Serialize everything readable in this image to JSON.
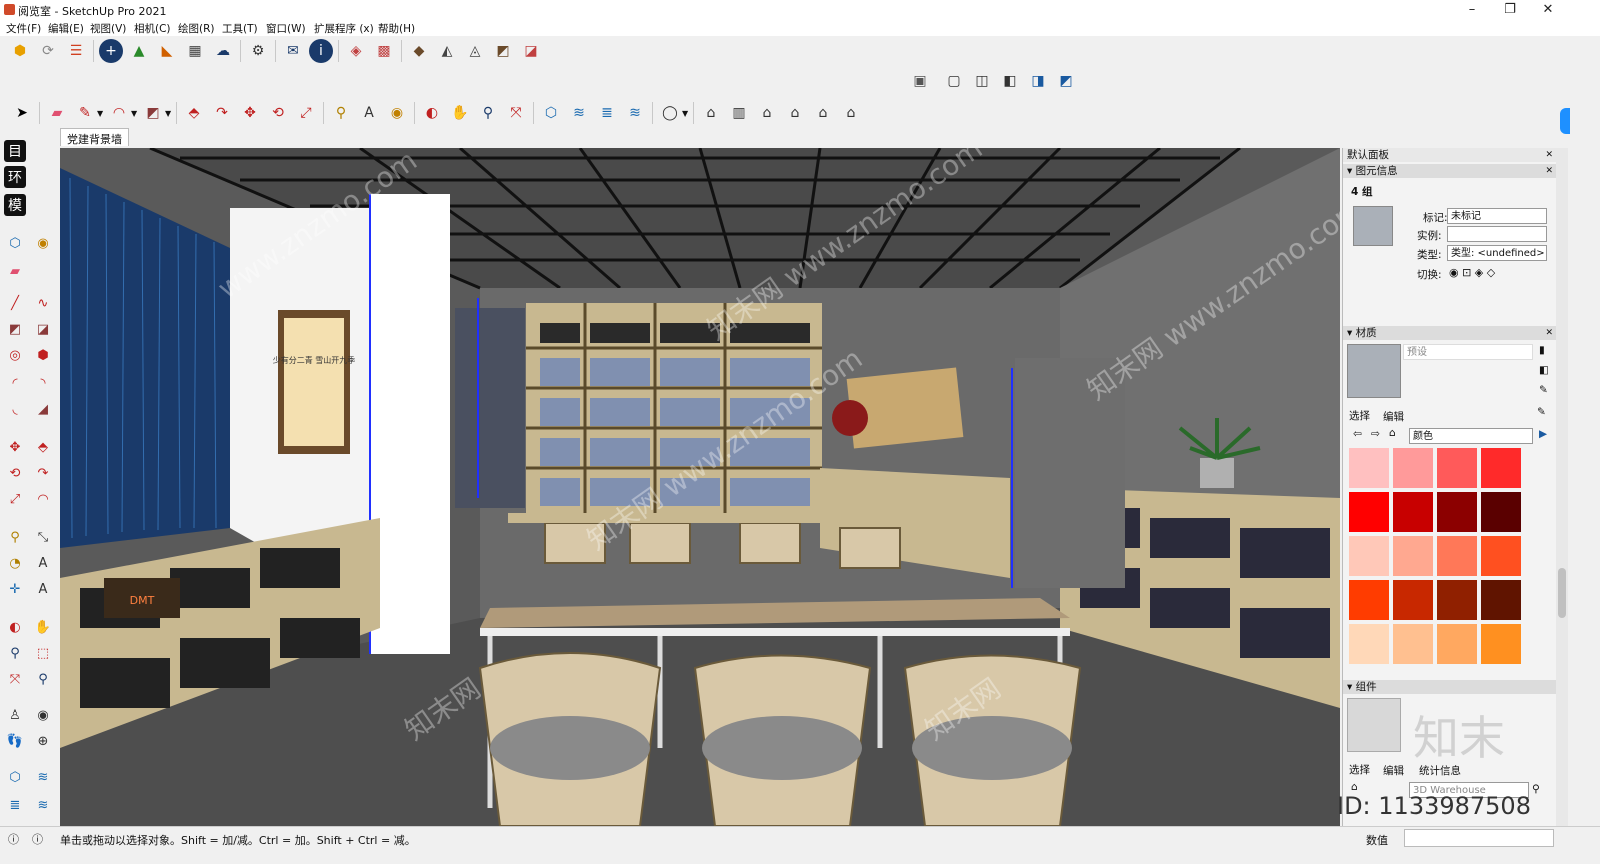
{
  "window": {
    "title": "阅览室 - SketchUp Pro 2021",
    "minimize": "–",
    "maximize": "❐",
    "close": "✕"
  },
  "menu": [
    "文件(F)",
    "编辑(E)",
    "视图(V)",
    "相机(C)",
    "绘图(R)",
    "工具(T)",
    "窗口(W)",
    "扩展程序 (x)",
    "帮助(H)"
  ],
  "scene_tab": "党建背景墙",
  "left_panel_letters": [
    "目",
    "环",
    "模"
  ],
  "panel": {
    "title": "默认面板",
    "entity_info": {
      "header": "图元信息",
      "count": "4 组",
      "tag_label": "标记:",
      "tag_value": "未标记",
      "instance_label": "实例:",
      "instance_value": "",
      "type_label": "类型:",
      "type_value": "类型: <undefined>",
      "toggle_label": "切换:"
    },
    "materials": {
      "header": "材质",
      "name_placeholder": "预设",
      "tab_select": "选择",
      "tab_edit": "编辑",
      "library": "颜色",
      "swatches": [
        "#ffc0c0",
        "#ff9a9a",
        "#ff5a5a",
        "#ff2a2a",
        "#ff0000",
        "#c80000",
        "#8c0000",
        "#5a0000",
        "#ffc8b8",
        "#ffa890",
        "#ff7858",
        "#ff5020",
        "#ff3c00",
        "#c82800",
        "#902000",
        "#601400",
        "#ffd8b8",
        "#ffc090",
        "#ffa860",
        "#ff9020"
      ]
    },
    "components": {
      "header": "组件",
      "tab_select": "选择",
      "tab_edit": "编辑",
      "tab_stats": "统计信息",
      "search_placeholder": "3D Warehouse"
    }
  },
  "status": {
    "text": "单击或拖动以选择对象。Shift = 加/减。Ctrl = 加。Shift + Ctrl = 减。",
    "value_label": "数值"
  },
  "scene": {
    "scroll_text": "少有分二青 雪山开九季",
    "screen_text": "DMT",
    "watermarks": [
      "www.znzmo.com",
      "知末网 www.znzmo.com",
      "知末网 www.znzmo.com",
      "知末网 www.znzmo.com",
      "知末网",
      "知末网"
    ],
    "logo_text": "知末",
    "id_text": "ID: 1133987508"
  }
}
